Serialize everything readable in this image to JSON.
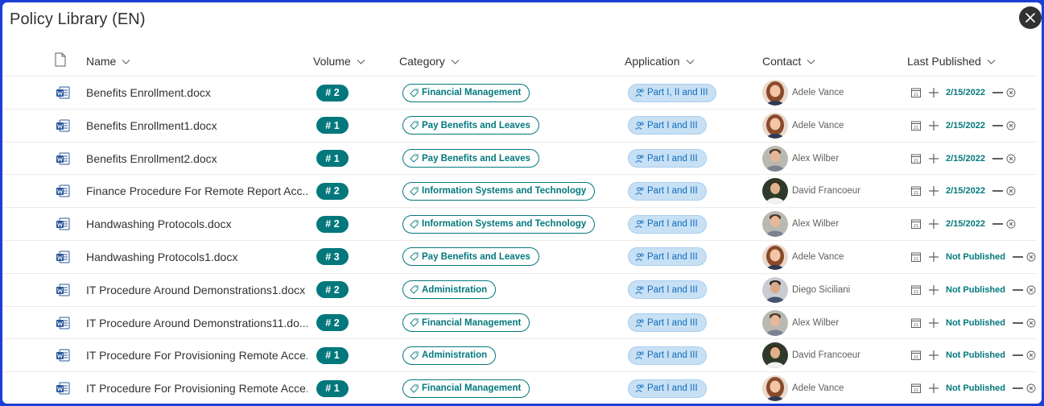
{
  "panel": {
    "title": "Policy Library (EN)"
  },
  "columns": {
    "name": "Name",
    "volume": "Volume",
    "category": "Category",
    "application": "Application",
    "contact": "Contact",
    "last_published": "Last Published"
  },
  "colors": {
    "accent": "#03787c",
    "app_pill_bg": "#c7e0f4",
    "app_pill_text": "#0f6cbd",
    "frame_border": "#1a3fd6"
  },
  "rows": [
    {
      "name": "Benefits Enrollment.docx",
      "volume": "# 2",
      "category": "Financial Management",
      "application": "Part I, II and III",
      "contact": "Adele Vance",
      "avatar": "adele",
      "published": "2/15/2022"
    },
    {
      "name": "Benefits Enrollment1.docx",
      "volume": "# 1",
      "category": "Pay Benefits and Leaves",
      "application": "Part I and III",
      "contact": "Adele Vance",
      "avatar": "adele",
      "published": "2/15/2022"
    },
    {
      "name": "Benefits Enrollment2.docx",
      "volume": "# 1",
      "category": "Pay Benefits and Leaves",
      "application": "Part I and III",
      "contact": "Alex Wilber",
      "avatar": "alex",
      "published": "2/15/2022"
    },
    {
      "name": "Finance Procedure For Remote Report Acc...",
      "volume": "# 2",
      "category": "Information Systems and Technology",
      "application": "Part I and III",
      "contact": "David Francoeur",
      "avatar": "david",
      "published": "2/15/2022"
    },
    {
      "name": "Handwashing Protocols.docx",
      "volume": "# 2",
      "category": "Information Systems and Technology",
      "application": "Part I and III",
      "contact": "Alex Wilber",
      "avatar": "alex",
      "published": "2/15/2022"
    },
    {
      "name": "Handwashing Protocols1.docx",
      "volume": "# 3",
      "category": "Pay Benefits and Leaves",
      "application": "Part I and III",
      "contact": "Adele Vance",
      "avatar": "adele",
      "published": "Not Published"
    },
    {
      "name": "IT Procedure Around Demonstrations1.docx",
      "volume": "# 2",
      "category": "Administration",
      "application": "Part I and III",
      "contact": "Diego Siciliani",
      "avatar": "diego",
      "published": "Not Published"
    },
    {
      "name": "IT Procedure Around Demonstrations11.do...",
      "volume": "# 2",
      "category": "Financial Management",
      "application": "Part I and III",
      "contact": "Alex Wilber",
      "avatar": "alex",
      "published": "Not Published"
    },
    {
      "name": "IT Procedure For Provisioning Remote Acce...",
      "volume": "# 1",
      "category": "Administration",
      "application": "Part I and III",
      "contact": "David Francoeur",
      "avatar": "david",
      "published": "Not Published"
    },
    {
      "name": "IT Procedure For Provisioning Remote Acce...",
      "volume": "# 1",
      "category": "Financial Management",
      "application": "Part I and III",
      "contact": "Adele Vance",
      "avatar": "adele",
      "published": "Not Published"
    }
  ]
}
